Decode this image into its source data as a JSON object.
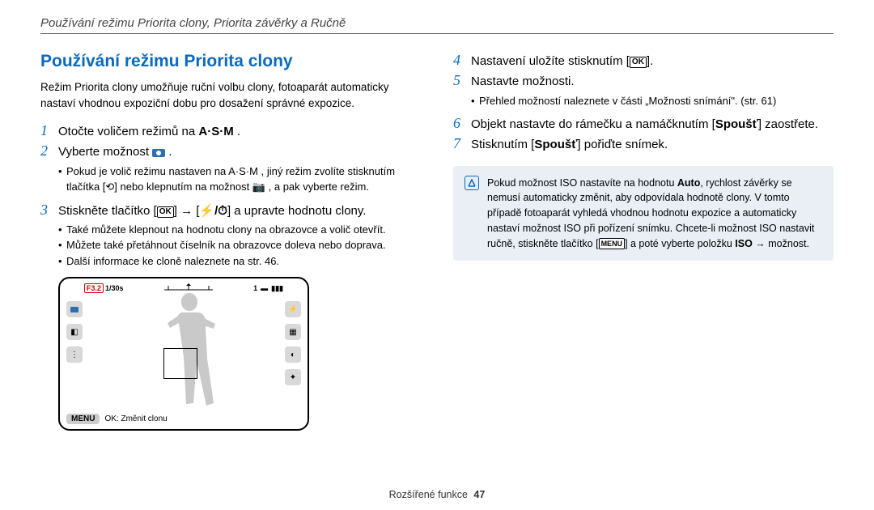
{
  "header": {
    "breadcrumb": "Používání režimu Priorita clony, Priorita závěrky a Ručně"
  },
  "left": {
    "title": "Používání režimu Priorita clony",
    "intro": "Režim Priorita clony umožňuje ruční volbu clony, fotoaparát automaticky nastaví vhodnou expoziční dobu pro dosažení správné expozice.",
    "step1": "Otočte voličem režimů na ",
    "step1_icon_label": "A·S·M",
    "step2": "Vyberte možnost ",
    "step2_bullets": [
      "Pokud je volič režimu nastaven na A·S·M , jiný režim zvolíte stisknutím tlačítka [⟲] nebo klepnutím na možnost 📷 , a pak vyberte režim."
    ],
    "step3_pre": "Stiskněte tlačítko [",
    "step3_mid": "] → [",
    "step3_post": "] a upravte hodnotu clony.",
    "step3_ok": "OK",
    "step3_flash_timer": "⚡/⏱",
    "step3_bullets": [
      "Také můžete klepnout na hodnotu clony na obrazovce a volič otevřít.",
      "Můžete také přetáhnout číselník na obrazovce doleva nebo doprava.",
      "Další informace ke cloně naleznete na str. 46."
    ]
  },
  "lcd": {
    "fval": "F3.2",
    "shutter": "1/30s",
    "counter_left": "1",
    "menu": "MENU",
    "ok_text": "OK: Změnit clonu"
  },
  "right": {
    "step4_pre": "Nastavení uložíte stisknutím [",
    "step4_ok": "OK",
    "step4_post": "].",
    "step5": "Nastavte možnosti.",
    "step5_bullets": [
      "Přehled možností naleznete v části „Možnosti snímání\". (str. 61)"
    ],
    "step6_pre": "Objekt nastavte do rámečku a namáčknutím [",
    "step6_btn": "Spoušť",
    "step6_post": "] zaostřete.",
    "step7_pre": "Stisknutím [",
    "step7_btn": "Spoušť",
    "step7_post": "] pořiďte snímek.",
    "info_pre": "Pokud možnost ISO nastavíte na hodnotu ",
    "info_auto": "Auto",
    "info_mid": ", rychlost závěrky se nemusí automaticky změnit, aby odpovídala hodnotě clony. V tomto případě fotoaparát vyhledá vhodnou hodnotu expozice a automaticky nastaví možnost ISO při pořízení snímku. Chcete-li možnost ISO nastavit ručně, stiskněte tlačítko [",
    "info_menu": "MENU",
    "info_post": "] a poté vyberte položku ",
    "info_iso": "ISO",
    "info_tail": " → možnost."
  },
  "footer": {
    "label": "Rozšířené funkce",
    "page": "47"
  }
}
